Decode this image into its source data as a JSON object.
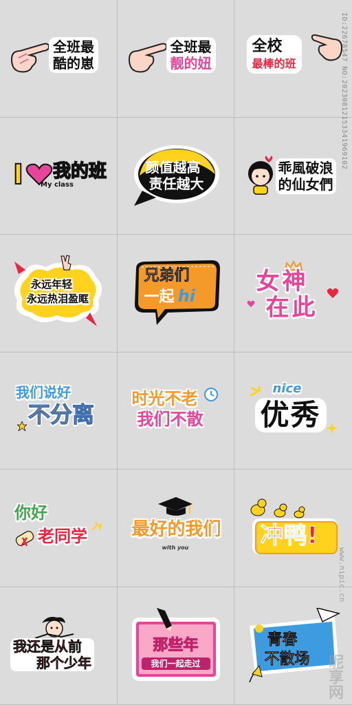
{
  "stickers": [
    {
      "line1": "全班最",
      "line2": "酷的崽"
    },
    {
      "line1": "全班最",
      "line2": "靓的妞"
    },
    {
      "line1": "全校",
      "line2": "最棒的班"
    },
    {
      "line1": "I",
      "line2": "我的班",
      "sub": "My class"
    },
    {
      "line1": "颜值越高",
      "line2": "责任越大"
    },
    {
      "line1": "乖風破浪",
      "line2": "的仙女們"
    },
    {
      "line1": "永远年轻",
      "line2": "永远热泪盈眶"
    },
    {
      "line1": "兄弟们",
      "line2": "一起",
      "accent": "hi"
    },
    {
      "line1": "女神",
      "line2": "在此"
    },
    {
      "line1": "我们说好",
      "line2": "不分离"
    },
    {
      "line1": "时光不老",
      "line2": "我们不散"
    },
    {
      "line1": "nice",
      "line2": "优秀"
    },
    {
      "line1": "你好",
      "line2": "老同学"
    },
    {
      "line1": "最好的我们",
      "sub": "with you"
    },
    {
      "line1": "冲鸭!"
    },
    {
      "line1": "我还是从前",
      "line2": "那个少年"
    },
    {
      "line1": "那些年",
      "line2": "我们一起走过"
    },
    {
      "line1": "青春",
      "line2": "不散场"
    }
  ],
  "watermark": {
    "id": "ID:22678547 NO:20230812153341969102",
    "site": "www.nipic.cn",
    "logo": "昵享网"
  },
  "colors": {
    "bg": "#d9d9d9",
    "black": "#111111",
    "red": "#e8263f",
    "pink": "#e6459a",
    "yellow": "#ffd21e",
    "orange": "#f39a2b",
    "blue": "#3d9be0",
    "green": "#3fa84a"
  }
}
